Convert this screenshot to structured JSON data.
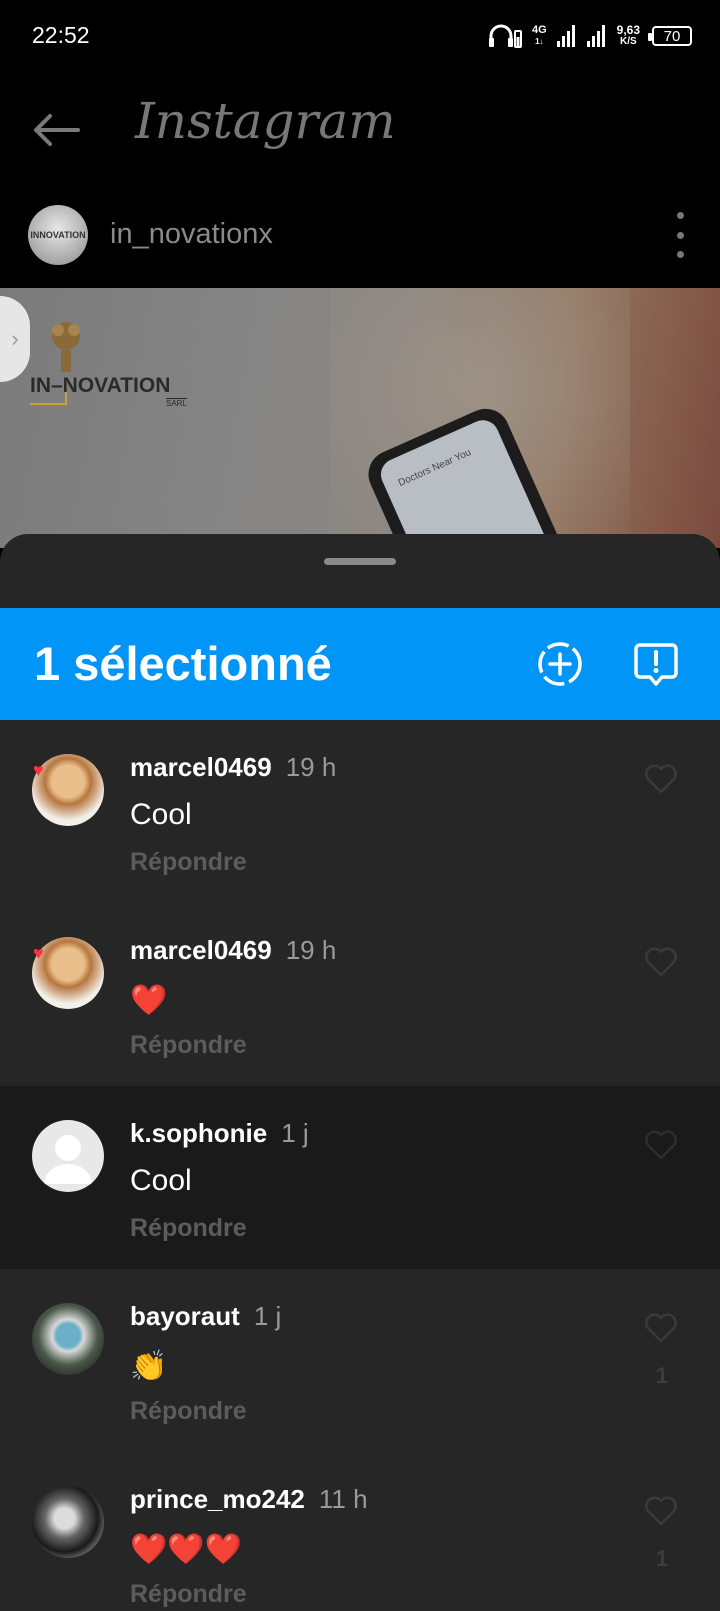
{
  "status_bar": {
    "time": "22:52",
    "network_top": "4G",
    "network_bottom": "1↓",
    "speed_value": "9,63",
    "speed_unit": "K/S",
    "battery": "70"
  },
  "header": {
    "title": "Instagram"
  },
  "post": {
    "username": "in_novationx",
    "avatar_text": "INNOVATION",
    "brand_text": "IN–NOVATION",
    "brand_sub": "SARL",
    "screen_text": "Doctors Near You"
  },
  "selection": {
    "title": "1 sélectionné"
  },
  "comments": [
    {
      "username": "marcel0469",
      "time": "19 h",
      "text": "Cool",
      "reply": "Répondre",
      "like_count": "",
      "selected": false
    },
    {
      "username": "marcel0469",
      "time": "19 h",
      "text": "❤️",
      "reply": "Répondre",
      "like_count": "",
      "selected": false
    },
    {
      "username": "k.sophonie",
      "time": "1 j",
      "text": "Cool",
      "reply": "Répondre",
      "like_count": "",
      "selected": true
    },
    {
      "username": "bayoraut",
      "time": "1 j",
      "text": "👏",
      "reply": "Répondre",
      "like_count": "1",
      "selected": false
    },
    {
      "username": "prince_mo242",
      "time": "11 h",
      "text": "❤️❤️❤️",
      "reply": "Répondre",
      "like_count": "1",
      "selected": false
    }
  ],
  "colors": {
    "accent": "#0095f6",
    "sheet_bg": "#262626",
    "selected_row_bg": "#1a1a1a"
  },
  "icons": {
    "back": "arrow-left-icon",
    "more": "more-vertical-icon",
    "add": "add-circle-dashed-icon",
    "report": "report-bubble-icon",
    "like": "heart-outline-icon"
  }
}
